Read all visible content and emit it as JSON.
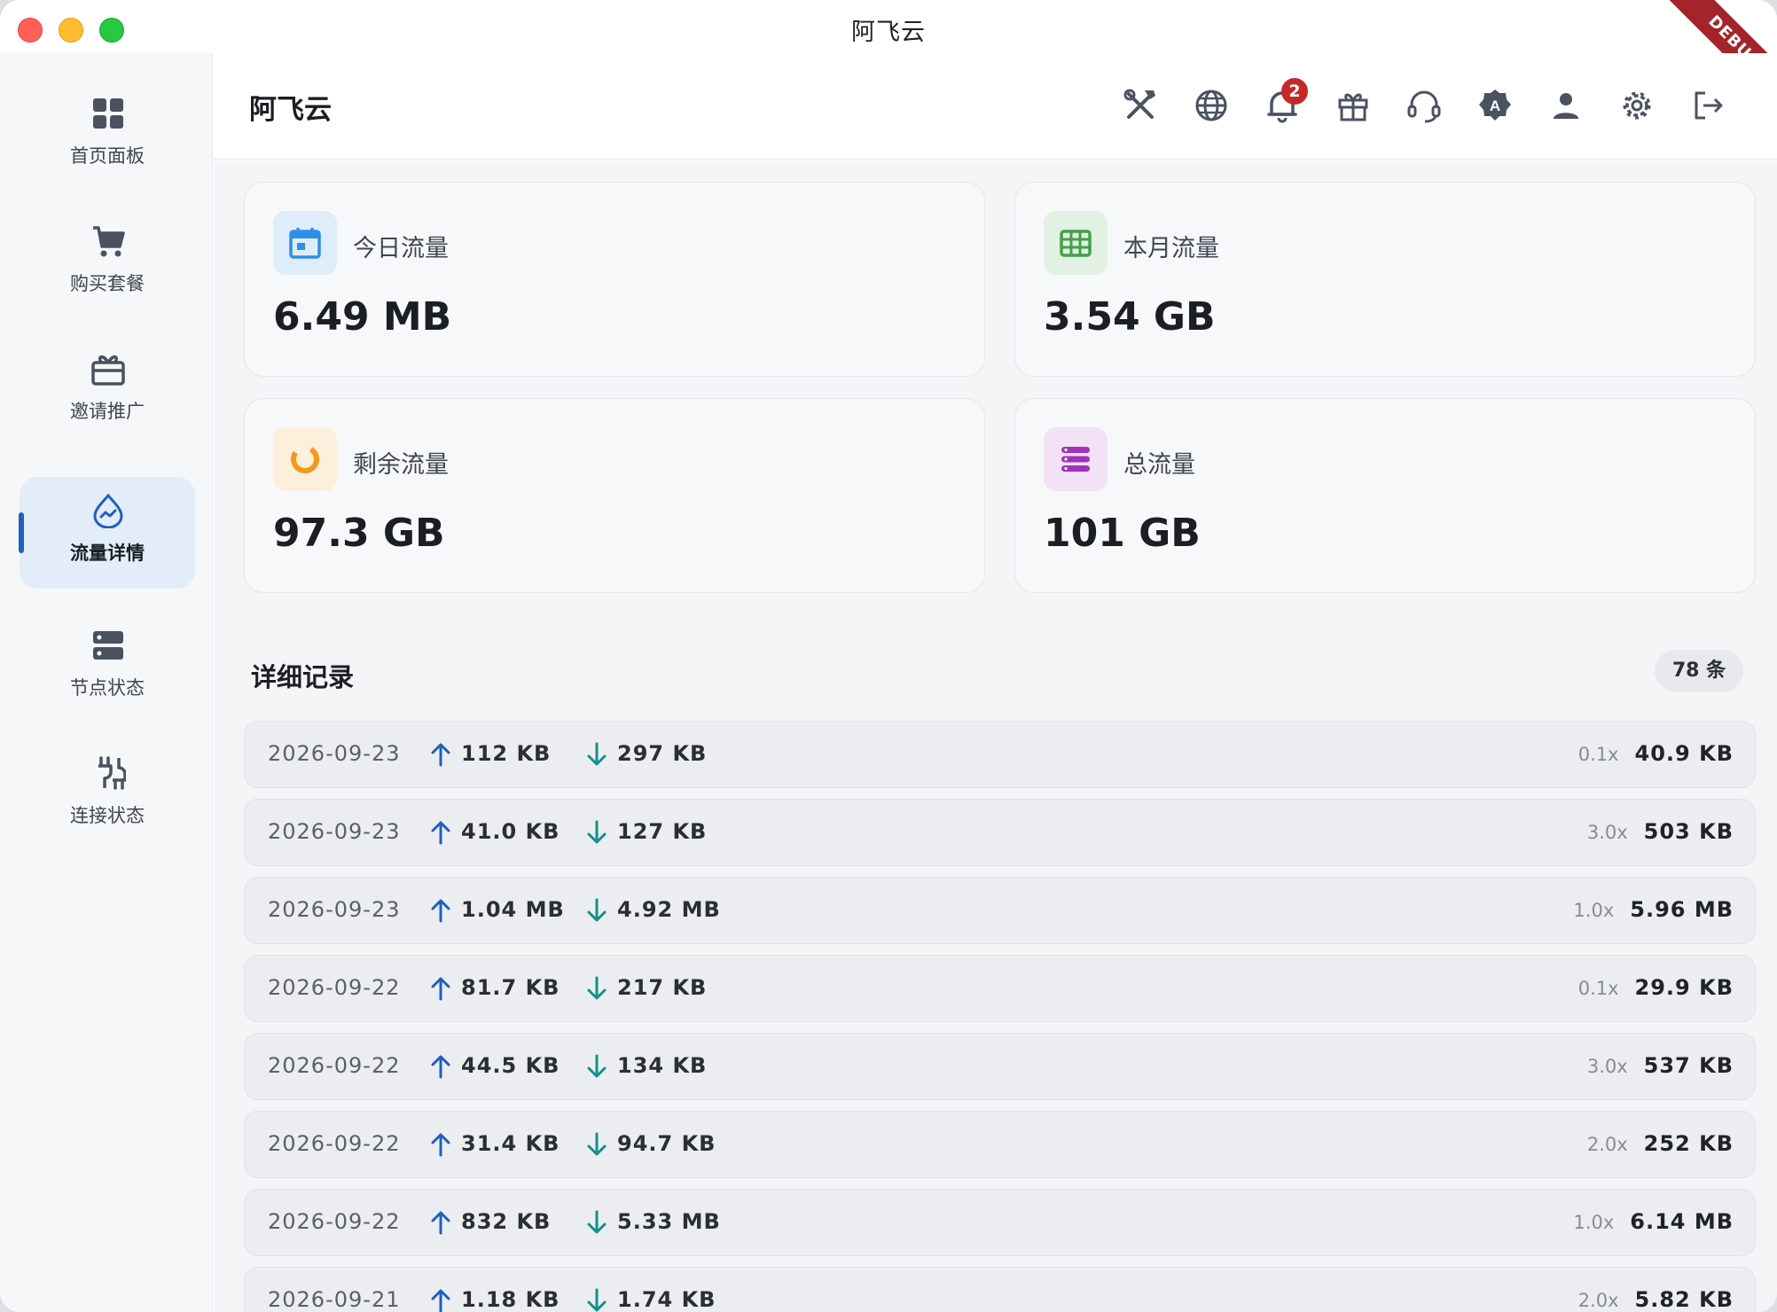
{
  "window": {
    "title": "阿飞云",
    "debug_label": "DEBUG"
  },
  "sidebar": {
    "items": [
      {
        "label": "首页面板",
        "icon": "dashboard-grid-icon"
      },
      {
        "label": "购买套餐",
        "icon": "shopping-cart-icon"
      },
      {
        "label": "邀请推广",
        "icon": "gift-box-icon"
      },
      {
        "label": "流量详情",
        "icon": "traffic-drop-icon",
        "active": true
      },
      {
        "label": "节点状态",
        "icon": "server-icon"
      },
      {
        "label": "连接状态",
        "icon": "connection-plug-icon"
      }
    ]
  },
  "header": {
    "title": "阿飞云",
    "notification_count": "2",
    "icons": [
      "tools-icon",
      "globe-icon",
      "bell-icon",
      "gift-icon",
      "headset-icon",
      "translate-badge-icon",
      "user-icon",
      "gear-icon",
      "logout-icon"
    ]
  },
  "cards": [
    {
      "label": "今日流量",
      "value": "6.49 MB",
      "icon": "calendar-icon",
      "accent": "#2f8ee5",
      "bg": "#dfecfa"
    },
    {
      "label": "本月流量",
      "value": "3.54 GB",
      "icon": "grid-calendar-icon",
      "accent": "#43a047",
      "bg": "#e2f1e3"
    },
    {
      "label": "剩余流量",
      "value": "97.3 GB",
      "icon": "ring-progress-icon",
      "accent": "#f39a1b",
      "bg": "#fcefdc"
    },
    {
      "label": "总流量",
      "value": "101 GB",
      "icon": "storage-stack-icon",
      "accent": "#a033b8",
      "bg": "#f3e2f6"
    }
  ],
  "records": {
    "title": "详细记录",
    "count_label": "78 条",
    "rows": [
      {
        "date": "2026-09-23",
        "up": "112 KB",
        "down": "297 KB",
        "rate": "0.1x",
        "total": "40.9 KB"
      },
      {
        "date": "2026-09-23",
        "up": "41.0 KB",
        "down": "127 KB",
        "rate": "3.0x",
        "total": "503 KB"
      },
      {
        "date": "2026-09-23",
        "up": "1.04 MB",
        "down": "4.92 MB",
        "rate": "1.0x",
        "total": "5.96 MB"
      },
      {
        "date": "2026-09-22",
        "up": "81.7 KB",
        "down": "217 KB",
        "rate": "0.1x",
        "total": "29.9 KB"
      },
      {
        "date": "2026-09-22",
        "up": "44.5 KB",
        "down": "134 KB",
        "rate": "3.0x",
        "total": "537 KB"
      },
      {
        "date": "2026-09-22",
        "up": "31.4 KB",
        "down": "94.7 KB",
        "rate": "2.0x",
        "total": "252 KB"
      },
      {
        "date": "2026-09-22",
        "up": "832 KB",
        "down": "5.33 MB",
        "rate": "1.0x",
        "total": "6.14 MB"
      },
      {
        "date": "2026-09-21",
        "up": "1.18 KB",
        "down": "1.74 KB",
        "rate": "2.0x",
        "total": "5.82 KB"
      }
    ]
  },
  "colors": {
    "active_nav_bg": "#e3edf9",
    "active_indicator": "#1f5fbf",
    "up_arrow": "#1f5fbf",
    "down_arrow": "#12908a"
  }
}
